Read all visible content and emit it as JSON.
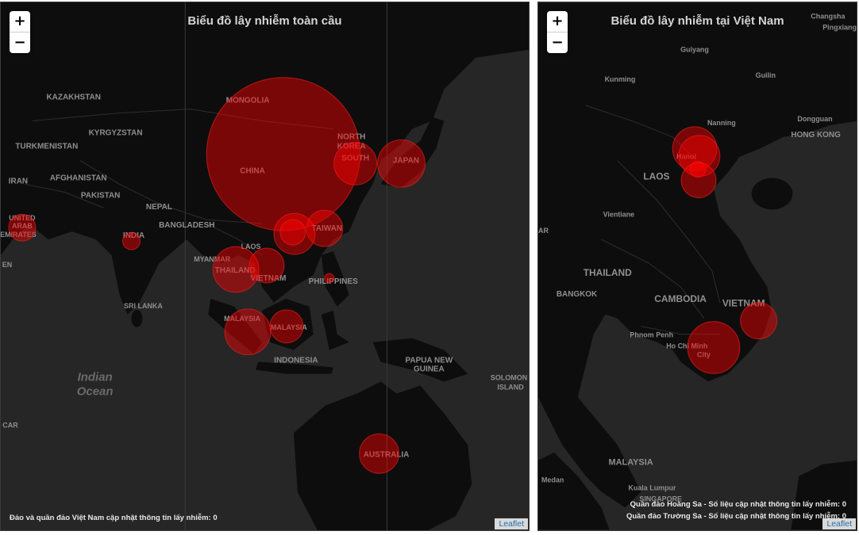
{
  "world_map": {
    "title": "Biểu đồ lây nhiễm toàn cầu",
    "zoom_in": "+",
    "zoom_out": "−",
    "note": "Đảo và quần đảo Việt Nam cập nhật thông tin lấy nhiễm: 0",
    "attribution": "Leaflet",
    "labels": {
      "kazakhstan": "KAZAKHSTAN",
      "mongolia": "MONGOLIA",
      "kyrgyzstan": "KYRGYZSTAN",
      "turkmenistan": "TURKMENISTAN",
      "afghanistan": "AFGHANISTAN",
      "iran": "IRAN",
      "pakistan": "PAKISTAN",
      "nepal": "NEPAL",
      "china": "CHINA",
      "north_korea_1": "NORTH",
      "north_korea_2": "KOREA",
      "south_korea": "SOUTH",
      "japan": "JAPAN",
      "uae_1": "UNITED",
      "uae_2": "ARAB",
      "uae_3": "EMIRATES",
      "india": "INDIA",
      "bangladesh": "BANGLADESH",
      "taiwan": "TAIWAN",
      "laos": "LAOS",
      "myanmar": "MYANMAR",
      "thailand": "THAILAND",
      "vietnam": "VIETNAM",
      "philippines": "PHILIPPINES",
      "sri_lanka": "SRI LANKA",
      "malaysia_1": "MALAYSIA",
      "malaysia_2": "MALAYSIA",
      "indonesia": "INDONESIA",
      "png_1": "PAPUA NEW",
      "png_2": "GUINEA",
      "solomon_1": "SOLOMON",
      "solomon_2": "ISLAND",
      "indian_ocean_1": "Indian",
      "indian_ocean_2": "Ocean",
      "australia": "AUSTRALIA",
      "edge_car": "CAR",
      "edge_en": "EN"
    }
  },
  "vn_map": {
    "title": "Biểu đồ lây nhiễm tại Việt Nam",
    "zoom_in": "+",
    "zoom_out": "−",
    "note_1": "Quần đảo Hoàng Sa - Số liệu cập nhật thông tin lấy nhiễm: 0",
    "note_2": "Quần đảo Trường Sa - Số liệu cập nhật thông tin lấy nhiễm: 0",
    "attribution": "Leaflet",
    "labels": {
      "changsha": "Changsha",
      "pingxiang": "Pingxiang",
      "guiyang": "Guiyang",
      "kunming": "Kunming",
      "guilin": "Guilin",
      "dongguan": "Dongguan",
      "hong_kong": "HONG KONG",
      "nanning": "Nanning",
      "hanoi": "Hanoi",
      "laos": "LAOS",
      "vientiane": "Vientiane",
      "thailand": "THAILAND",
      "bangkok": "BANGKOK",
      "cambodia": "CAMBODIA",
      "vietnam": "VIETNAM",
      "phnom_penh": "Phnom Penh",
      "hcmc_1": "Ho Chi Minh",
      "hcmc_2": "City",
      "malaysia": "MALAYSIA",
      "medan": "Medan",
      "kuala_lumpur": "Kuala Lumpur",
      "singapore": "SINGAPORE",
      "edge_ar": "AR"
    }
  },
  "colors": {
    "land": "#0d0d0d",
    "water": "#262626",
    "bubble": "#ff0000",
    "bubble_stroke": "#ff3030",
    "label": "#9a9a9a"
  }
}
